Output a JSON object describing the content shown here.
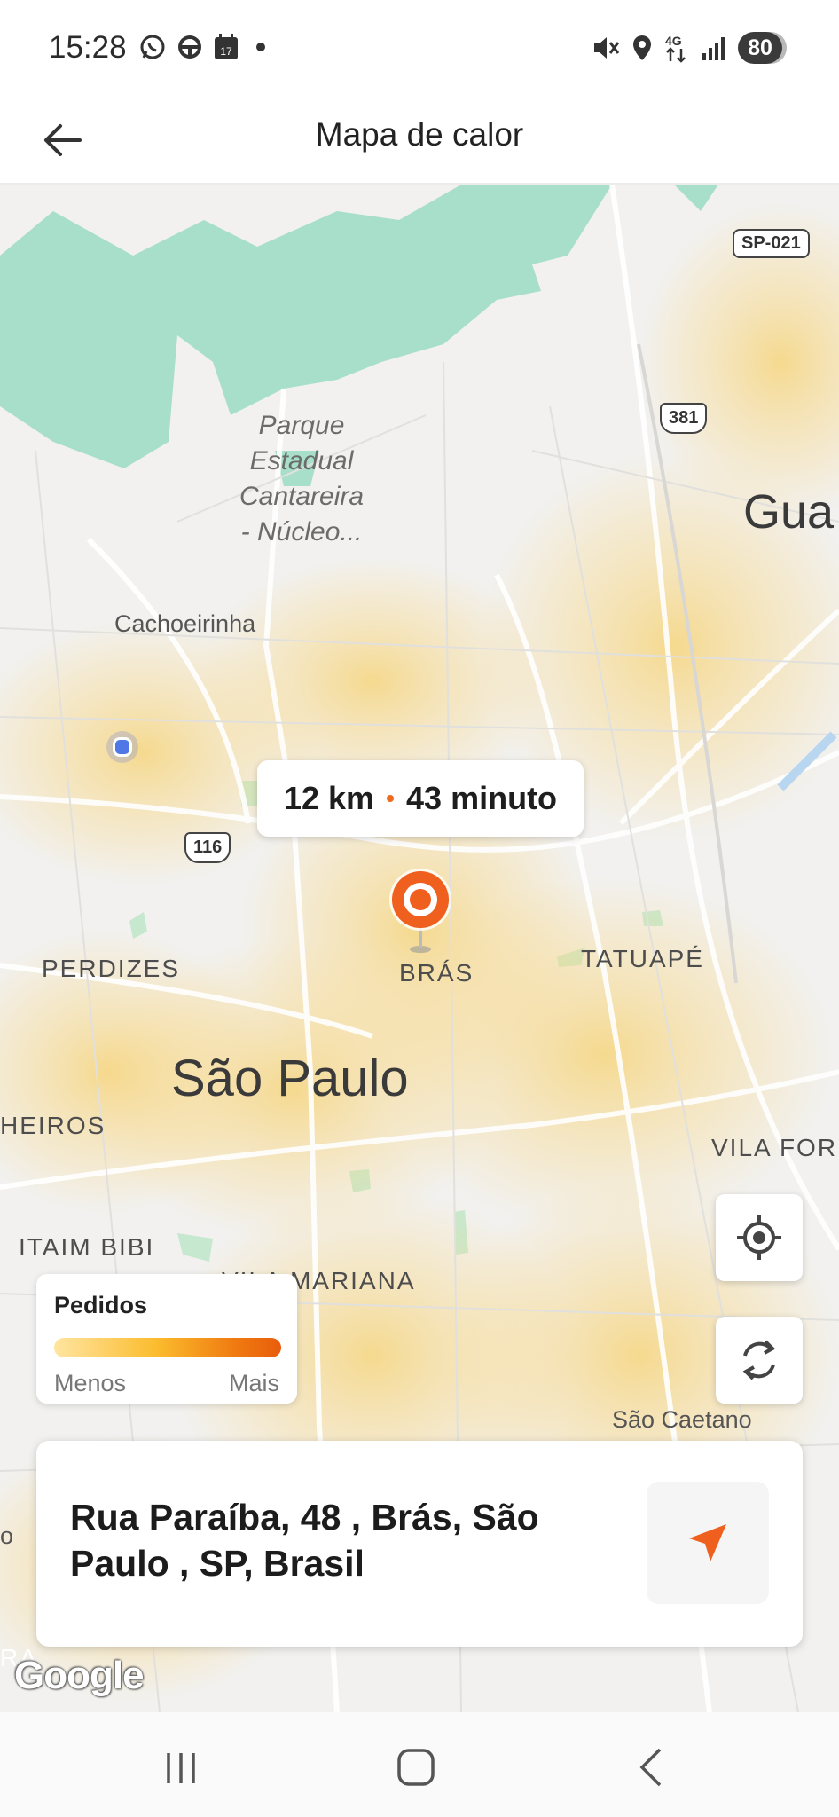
{
  "status_bar": {
    "time": "15:28",
    "battery": "80",
    "left_icons": [
      "whatsapp-icon",
      "steering-wheel-icon",
      "calendar-icon",
      "dot-icon"
    ],
    "right_icons": [
      "mute-icon",
      "location-icon",
      "4g-icon",
      "signal-icon"
    ],
    "calendar_day": "17",
    "network": "4G"
  },
  "app_bar": {
    "title": "Mapa de calor",
    "back_icon": "arrow-left-icon"
  },
  "map": {
    "labels": {
      "park": "Parque Estadual Cantareira - Núcleo...",
      "park_lines": [
        "Parque",
        "Estadual",
        "Cantareira",
        "- Núcleo..."
      ],
      "cachoeirinha": "Cachoeirinha",
      "guarulhos": "Gua",
      "perdizes": "PERDIZES",
      "bras": "BRÁS",
      "tatuape": "TATUAPÉ",
      "sao_paulo": "São Paulo",
      "pinheiros": "HEIROS",
      "vila_formosa": "VILA FOR",
      "itaim_bibi": "ITAIM BIBI",
      "vila_mariana": "VILA MARIANA",
      "sao_caetano": "São Caetano",
      "edge_left": "o",
      "edge_left2": "RA"
    },
    "shields": {
      "sp021": "SP-021",
      "r381": "381",
      "r116": "116"
    },
    "route_info": {
      "distance": "12 km",
      "duration": "43 minuto"
    },
    "pin_icon": "map-pin-icon",
    "my_location_icon": "current-location-dot-icon",
    "colors": {
      "accent": "#EF5F1E",
      "park": "#A7DFCB",
      "heat": "#F9D98A",
      "map_bg": "#F2F1EF"
    }
  },
  "controls": {
    "locate_icon": "crosshair-icon",
    "refresh_icon": "refresh-icon"
  },
  "legend": {
    "title": "Pedidos",
    "min_label": "Menos",
    "max_label": "Mais"
  },
  "address_card": {
    "address": "Rua Paraíba, 48 , Brás, São Paulo , SP, Brasil",
    "navigate_icon": "navigation-arrow-icon"
  },
  "attribution": "Google",
  "system_nav": {
    "recents_icon": "recents-icon",
    "home_icon": "home-icon",
    "back_icon": "back-chevron-icon"
  }
}
